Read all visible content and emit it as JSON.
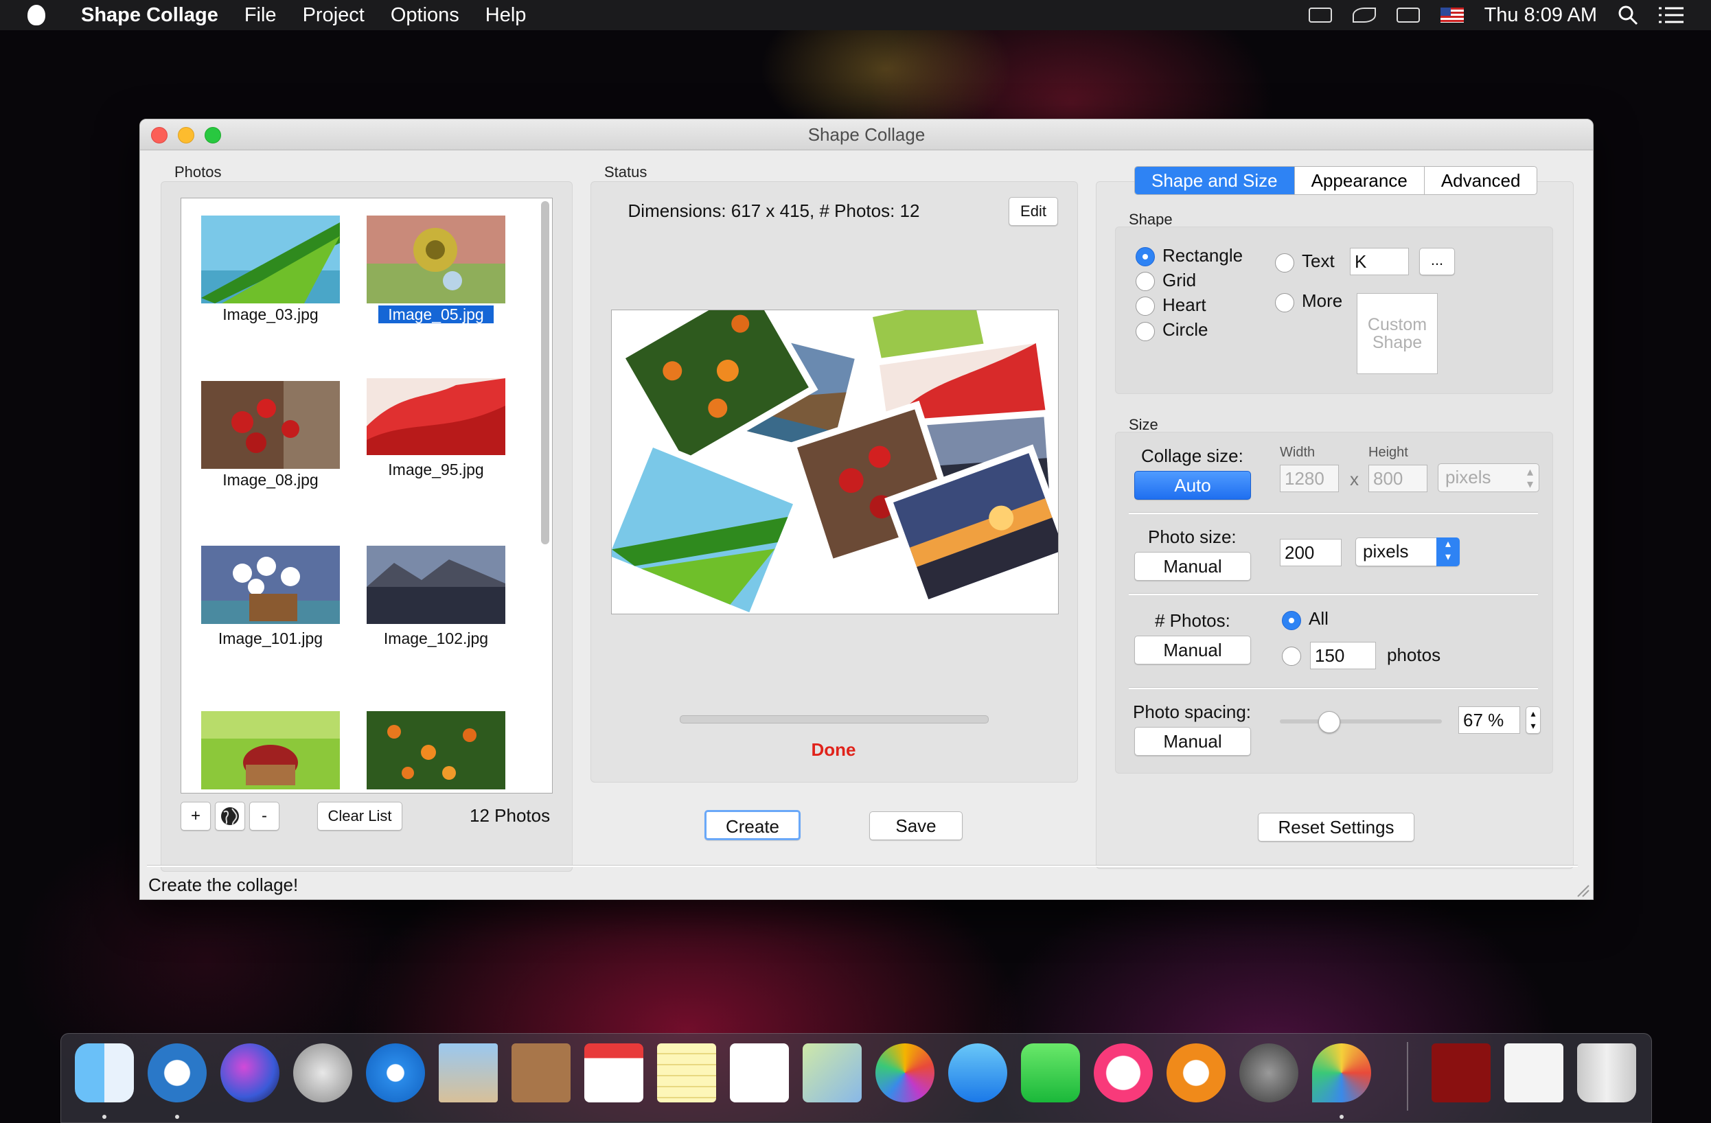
{
  "menubar": {
    "app_name": "Shape Collage",
    "items": [
      "File",
      "Project",
      "Options",
      "Help"
    ],
    "clock": "Thu 8:09 AM"
  },
  "window": {
    "title": "Shape Collage",
    "status_bar": "Create the collage!"
  },
  "photos": {
    "label": "Photos",
    "items": [
      {
        "name": "Image_03.jpg",
        "selected": false
      },
      {
        "name": "Image_05.jpg",
        "selected": true
      },
      {
        "name": "Image_08.jpg",
        "selected": false
      },
      {
        "name": "Image_95.jpg",
        "selected": false
      },
      {
        "name": "Image_101.jpg",
        "selected": false
      },
      {
        "name": "Image_102.jpg",
        "selected": false
      }
    ],
    "add_label": "+",
    "remove_label": "-",
    "clear_label": "Clear List",
    "count": "12 Photos"
  },
  "status": {
    "label": "Status",
    "dimensions": "Dimensions: 617 x 415, # Photos: 12",
    "edit_label": "Edit",
    "done": "Done",
    "progress": 0
  },
  "actions": {
    "create": "Create",
    "save": "Save",
    "reset": "Reset Settings"
  },
  "tabs": [
    "Shape and Size",
    "Appearance",
    "Advanced"
  ],
  "shape": {
    "label": "Shape",
    "options": [
      "Rectangle",
      "Grid",
      "Heart",
      "Circle"
    ],
    "selected": "Rectangle",
    "text_label": "Text",
    "text_value": "K",
    "ellipsis": "...",
    "more_label": "More",
    "custom_shape": "Custom Shape"
  },
  "size": {
    "label": "Size",
    "collage_size": "Collage size:",
    "collage_mode": "Auto",
    "width_label": "Width",
    "height_label": "Height",
    "width": "1280",
    "x": "x",
    "height": "800",
    "unit": "pixels",
    "photo_size": "Photo size:",
    "photo_size_mode": "Manual",
    "photo_size_value": "200",
    "photo_unit": "pixels",
    "num_photos": "# Photos:",
    "num_photos_mode": "Manual",
    "all_label": "All",
    "count_value": "150",
    "photos_label": "photos",
    "spacing": "Photo spacing:",
    "spacing_mode": "Manual",
    "spacing_value": "67 %",
    "spacing_level": 0.3
  },
  "colors": {
    "accent": "#2e83f4",
    "done": "#e0231b",
    "selection": "#1566d6"
  }
}
